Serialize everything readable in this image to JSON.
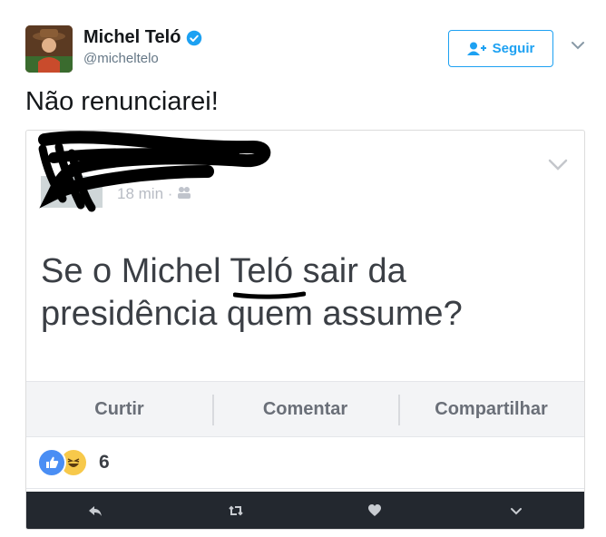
{
  "tweet": {
    "author_name": "Michel Teló",
    "handle": "@micheltelo",
    "follow_label": "Seguir",
    "text": "Não renunciarei!"
  },
  "embedded_post": {
    "time": "18 min",
    "post_text_line1": "Se o Michel Teló sair da",
    "post_text_line2": "presidência quem assume?",
    "actions": [
      "Curtir",
      "Comentar",
      "Compartilhar"
    ],
    "reaction_count": "6"
  },
  "icons": {
    "verified": "verified-badge-icon",
    "follow": "add-user-icon",
    "reply": "reply-icon",
    "retweet": "retweet-icon",
    "like": "heart-icon",
    "more": "chevron-down-icon"
  },
  "colors": {
    "accent": "#1da1f2",
    "dark_bar": "#23282f",
    "fb_like": "#4a8ef4",
    "fb_haha": "#f7c94b"
  }
}
